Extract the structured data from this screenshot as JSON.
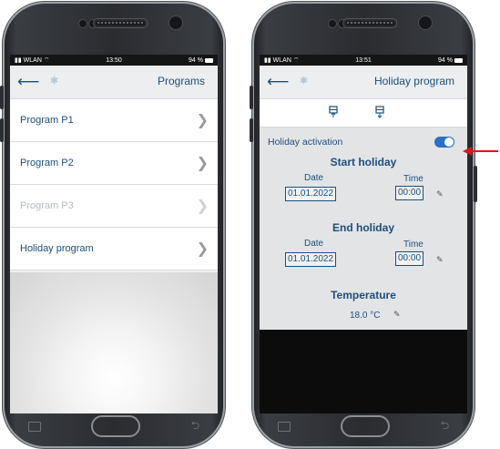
{
  "left_phone": {
    "status": {
      "network": "WLAN",
      "time": "13:50",
      "battery": "94 %"
    },
    "header": {
      "title": "Programs",
      "back_icon": "arrow-left-icon",
      "bluetooth_icon": "bluetooth-icon"
    },
    "programs": [
      {
        "label": "Program P1",
        "enabled": true
      },
      {
        "label": "Program P2",
        "enabled": true
      },
      {
        "label": "Program P3",
        "enabled": false
      },
      {
        "label": "Holiday program",
        "enabled": true
      }
    ]
  },
  "right_phone": {
    "status": {
      "network": "WLAN",
      "time": "13:51",
      "battery": "94 %"
    },
    "header": {
      "title": "Holiday program",
      "back_icon": "arrow-left-icon",
      "bluetooth_icon": "bluetooth-icon"
    },
    "toolbar": {
      "upload_icon": "upload-thermostat-icon",
      "download_icon": "download-thermostat-icon"
    },
    "holiday": {
      "activation_label": "Holiday activation",
      "activation_on": true,
      "start_heading": "Start holiday",
      "start_date_label": "Date",
      "start_date": "01.01.2022",
      "start_time_label": "Time",
      "start_time": "00:00",
      "end_heading": "End holiday",
      "end_date_label": "Date",
      "end_date": "01.01.2022",
      "end_time_label": "Time",
      "end_time": "00:00",
      "temperature_heading": "Temperature",
      "temperature_value": "18.0 °C"
    }
  },
  "colors": {
    "accent": "#1f4e79",
    "toggle_on": "#2a6fc9",
    "annotation_arrow": "#e3121b"
  }
}
